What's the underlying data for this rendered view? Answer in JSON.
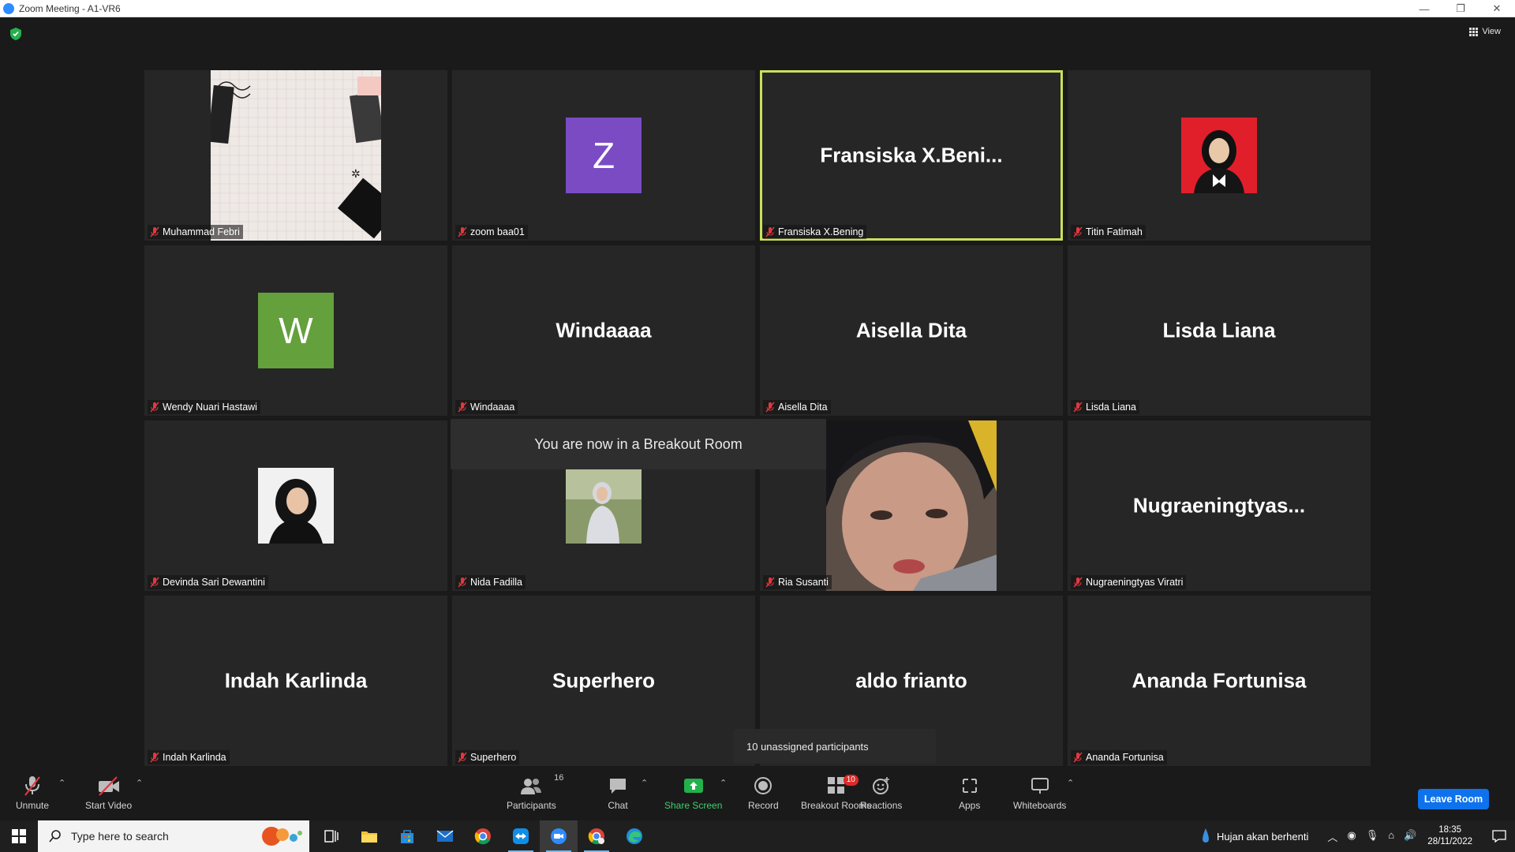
{
  "window": {
    "title": "Zoom Meeting - A1-VR6",
    "minimize": "—",
    "restore": "❐",
    "close": "✕"
  },
  "view_label": "View",
  "tiles": [
    {
      "id": "muhammad",
      "name": "Muhammad Febri"
    },
    {
      "id": "zoom",
      "name": "zoom baa01",
      "avatar_letter": "Z",
      "avatar_color": "#7b4bc4"
    },
    {
      "id": "fransiska",
      "name": "Fransiska X.Bening",
      "display": "Fransiska  X.Beni..."
    },
    {
      "id": "titin",
      "name": "Titin Fatimah"
    },
    {
      "id": "wendy",
      "name": "Wendy Nuari Hastawi",
      "avatar_letter": "W",
      "avatar_color": "#64a03c"
    },
    {
      "id": "windaaaa",
      "name": "Windaaaa",
      "display": "Windaaaa"
    },
    {
      "id": "aisella",
      "name": "Aisella Dita",
      "display": "Aisella Dita"
    },
    {
      "id": "lisda",
      "name": "Lisda Liana",
      "display": "Lisda Liana"
    },
    {
      "id": "devinda",
      "name": "Devinda Sari Dewantini"
    },
    {
      "id": "nida",
      "name": "Nida Fadilla"
    },
    {
      "id": "ria",
      "name": "Ria Susanti"
    },
    {
      "id": "nugraeningtyas",
      "name": "Nugraeningtyas Viratri",
      "display": "Nugraeningtyas..."
    },
    {
      "id": "indah",
      "name": "Indah Karlinda",
      "display": "Indah Karlinda"
    },
    {
      "id": "superhero",
      "name": "Superhero",
      "display": "Superhero"
    },
    {
      "id": "aldo",
      "name": "",
      "display": "aldo frianto"
    },
    {
      "id": "ananda",
      "name": "Ananda Fortunisa",
      "display": "Ananda Fortunisa"
    }
  ],
  "toast": "You are now in a Breakout Room",
  "unassigned": "10 unassigned participants",
  "toolbar": {
    "unmute": "Unmute",
    "start_video": "Start Video",
    "participants": "Participants",
    "participants_count": "16",
    "chat": "Chat",
    "share_screen": "Share Screen",
    "record": "Record",
    "breakout_rooms": "Breakout Rooms",
    "breakout_badge": "10",
    "reactions": "Reactions",
    "apps": "Apps",
    "whiteboards": "Whiteboards",
    "leave_room": "Leave Room"
  },
  "taskbar": {
    "search_placeholder": "Type here to search",
    "weather": "Hujan akan berhenti",
    "time": "18:35",
    "date": "28/11/2022"
  },
  "colors": {
    "active_speaker": "#c8e05a",
    "leave": "#0e72ed",
    "share": "#3fcf6f",
    "mic_off": "#e0383e"
  }
}
